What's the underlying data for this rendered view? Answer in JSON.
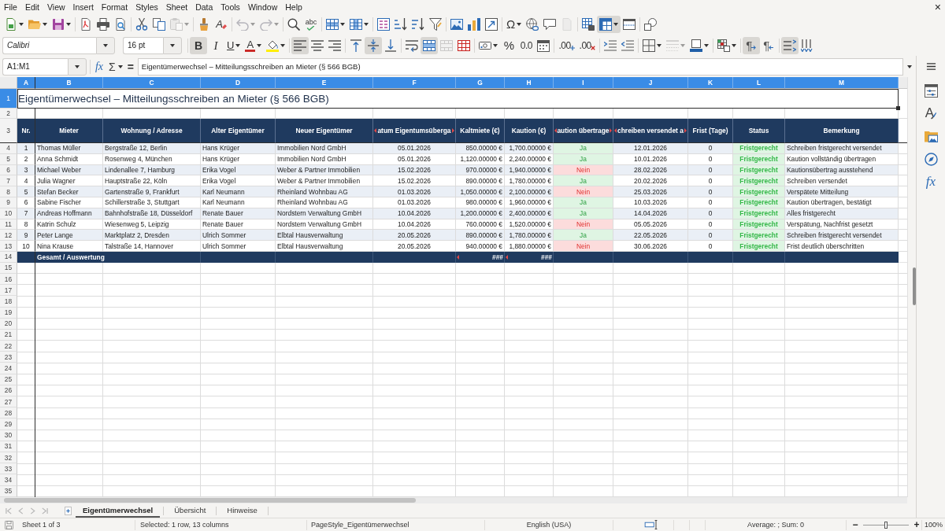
{
  "menu_bar": {
    "items": [
      "File",
      "Edit",
      "View",
      "Insert",
      "Format",
      "Styles",
      "Sheet",
      "Data",
      "Tools",
      "Window",
      "Help"
    ],
    "close": "×"
  },
  "standard_toolbar": {
    "groups": [
      {
        "buttons": [
          {
            "kind": "new",
            "dropdown": true,
            "on": false,
            "disabled": false
          },
          {
            "kind": "open",
            "dropdown": true,
            "on": false,
            "disabled": false
          },
          {
            "kind": "save",
            "dropdown": true,
            "on": false,
            "disabled": false
          }
        ]
      },
      {
        "buttons": [
          {
            "kind": "export_pdf",
            "dropdown": false,
            "on": false,
            "disabled": false
          },
          {
            "kind": "print",
            "dropdown": false,
            "on": false,
            "disabled": false
          },
          {
            "kind": "print_preview",
            "dropdown": false,
            "on": false,
            "disabled": false
          }
        ]
      },
      {
        "buttons": [
          {
            "kind": "cut",
            "dropdown": false,
            "on": false,
            "disabled": false
          },
          {
            "kind": "copy",
            "dropdown": false,
            "on": false,
            "disabled": false
          },
          {
            "kind": "paste",
            "dropdown": true,
            "on": false,
            "disabled": true
          }
        ]
      },
      {
        "buttons": [
          {
            "kind": "clone",
            "dropdown": false,
            "on": false,
            "disabled": false
          },
          {
            "kind": "clear_format",
            "label": "A",
            "dropdown": false,
            "on": false,
            "disabled": false
          }
        ]
      },
      {
        "buttons": [
          {
            "kind": "undo",
            "dropdown": true,
            "on": false,
            "disabled": true
          },
          {
            "kind": "redo",
            "dropdown": true,
            "on": false,
            "disabled": true
          }
        ]
      },
      {
        "buttons": [
          {
            "kind": "find_replace",
            "dropdown": false,
            "on": false,
            "disabled": false
          },
          {
            "kind": "spelling",
            "label": "abc",
            "dropdown": false,
            "on": false,
            "disabled": false
          }
        ]
      },
      {
        "buttons": [
          {
            "kind": "rows",
            "dropdown": true,
            "on": false,
            "disabled": false
          },
          {
            "kind": "columns",
            "dropdown": true,
            "on": false,
            "disabled": false
          }
        ]
      },
      {
        "buttons": [
          {
            "kind": "sort",
            "dropdown": false,
            "on": false,
            "disabled": false
          },
          {
            "kind": "sort_ascending",
            "dropdown": false,
            "on": false,
            "disabled": false
          },
          {
            "kind": "sort_descending",
            "dropdown": false,
            "on": false,
            "disabled": false
          },
          {
            "kind": "autofilter",
            "dropdown": false,
            "on": false,
            "disabled": false
          }
        ]
      },
      {
        "buttons": [
          {
            "kind": "image",
            "dropdown": false,
            "on": false,
            "disabled": false
          },
          {
            "kind": "chart",
            "dropdown": false,
            "on": false,
            "disabled": false
          },
          {
            "kind": "pivot_table",
            "dropdown": false,
            "on": false,
            "disabled": false
          }
        ]
      },
      {
        "buttons": [
          {
            "kind": "special_character",
            "label": "Ω",
            "dropdown": true,
            "on": false,
            "disabled": false
          },
          {
            "kind": "hyperlink",
            "dropdown": false,
            "on": false,
            "disabled": false
          },
          {
            "kind": "comment",
            "dropdown": false,
            "on": false,
            "disabled": false
          },
          {
            "kind": "header_footer",
            "dropdown": false,
            "on": false,
            "disabled": true
          }
        ]
      },
      {
        "buttons": [
          {
            "kind": "print_area",
            "dropdown": false,
            "on": false,
            "disabled": false
          },
          {
            "kind": "freeze",
            "dropdown": true,
            "on": true,
            "disabled": false
          },
          {
            "kind": "split_window",
            "dropdown": false,
            "on": false,
            "disabled": false
          }
        ]
      },
      {
        "buttons": [
          {
            "kind": "draw",
            "dropdown": false,
            "on": false,
            "disabled": false
          }
        ]
      }
    ]
  },
  "formatting_toolbar": {
    "font_name": "Calibri",
    "font_size": "16 pt",
    "groups": [
      {
        "buttons": [
          {
            "kind": "bold",
            "label": "B",
            "dropdown": false,
            "on": true,
            "disabled": false
          },
          {
            "kind": "italic",
            "label": "I",
            "dropdown": false,
            "on": false,
            "disabled": false
          },
          {
            "kind": "underline",
            "label": "U",
            "dropdown": true,
            "on": false,
            "disabled": false
          },
          {
            "kind": "font_color",
            "label": "A",
            "dropdown": true,
            "on": false,
            "disabled": false
          },
          {
            "kind": "highlight",
            "dropdown": true,
            "on": false,
            "disabled": false
          }
        ]
      },
      {
        "buttons": [
          {
            "kind": "align_left",
            "dropdown": false,
            "on": true,
            "disabled": false
          },
          {
            "kind": "align_center",
            "dropdown": false,
            "on": false,
            "disabled": false
          },
          {
            "kind": "align_right",
            "dropdown": false,
            "on": false,
            "disabled": false
          }
        ]
      },
      {
        "buttons": [
          {
            "kind": "align_top",
            "dropdown": false,
            "on": false,
            "disabled": false
          },
          {
            "kind": "align_middle",
            "dropdown": false,
            "on": true,
            "disabled": false
          },
          {
            "kind": "align_bottom",
            "dropdown": false,
            "on": false,
            "disabled": false
          }
        ]
      },
      {
        "buttons": [
          {
            "kind": "wrap_text",
            "dropdown": false,
            "on": false,
            "disabled": false
          },
          {
            "kind": "merge_center",
            "dropdown": false,
            "on": true,
            "disabled": false
          },
          {
            "kind": "merge_cells",
            "dropdown": false,
            "on": false,
            "disabled": true
          },
          {
            "kind": "unmerge_cells",
            "dropdown": false,
            "on": false,
            "disabled": false
          }
        ]
      },
      {
        "buttons": [
          {
            "kind": "number_format",
            "dropdown": true,
            "on": false,
            "disabled": false
          },
          {
            "kind": "percent",
            "label": "%",
            "dropdown": false,
            "on": false,
            "disabled": false
          },
          {
            "kind": "number",
            "label": "0.0",
            "dropdown": false,
            "on": false,
            "disabled": false
          },
          {
            "kind": "date",
            "dropdown": false,
            "on": false,
            "disabled": false
          }
        ]
      },
      {
        "buttons": [
          {
            "kind": "add_decimal",
            "label": ".00",
            "dropdown": false,
            "on": false,
            "disabled": false
          },
          {
            "kind": "delete_decimal",
            "label": ".00",
            "dropdown": false,
            "on": false,
            "disabled": false
          }
        ]
      },
      {
        "buttons": [
          {
            "kind": "indent_increase",
            "dropdown": false,
            "on": false,
            "disabled": false
          },
          {
            "kind": "indent_decrease",
            "dropdown": false,
            "on": false,
            "disabled": false
          }
        ]
      },
      {
        "buttons": [
          {
            "kind": "borders",
            "dropdown": true,
            "on": false,
            "disabled": false
          },
          {
            "kind": "border_style",
            "dropdown": true,
            "on": false,
            "disabled": true
          },
          {
            "kind": "border_color",
            "dropdown": true,
            "on": false,
            "disabled": false
          }
        ]
      },
      {
        "buttons": [
          {
            "kind": "conditional",
            "dropdown": true,
            "on": false,
            "disabled": false
          }
        ]
      },
      {
        "buttons": [
          {
            "kind": "left_to_right",
            "label": "¶",
            "dropdown": false,
            "on": true,
            "disabled": false
          },
          {
            "kind": "right_to_left",
            "label": "¶",
            "dropdown": false,
            "on": false,
            "disabled": false
          }
        ]
      },
      {
        "buttons": [
          {
            "kind": "text_horizontal",
            "dropdown": false,
            "on": true,
            "disabled": false
          },
          {
            "kind": "text_vertical",
            "dropdown": false,
            "on": false,
            "disabled": false
          }
        ]
      }
    ]
  },
  "formula_bar": {
    "name_box": "A1:M1",
    "function_wizard": "fx",
    "sum": "Σ",
    "equals": "=",
    "content": "Eigentümerwechsel – Mitteilungsschreiben an Mieter (§ 566 BGB)"
  },
  "spreadsheet": {
    "columns": [
      {
        "label": "A",
        "selected": true
      },
      {
        "label": "B",
        "selected": true
      },
      {
        "label": "C",
        "selected": true
      },
      {
        "label": "D",
        "selected": true
      },
      {
        "label": "E",
        "selected": true
      },
      {
        "label": "F",
        "selected": true
      },
      {
        "label": "G",
        "selected": true
      },
      {
        "label": "H",
        "selected": true
      },
      {
        "label": "I",
        "selected": true
      },
      {
        "label": "J",
        "selected": true
      },
      {
        "label": "K",
        "selected": true
      },
      {
        "label": "L",
        "selected": true
      },
      {
        "label": "M",
        "selected": true
      }
    ],
    "row_headers": [
      {
        "label": "1",
        "selected": true
      },
      {
        "label": "2",
        "selected": false
      },
      {
        "label": "3",
        "selected": false
      },
      {
        "label": "4",
        "selected": false
      },
      {
        "label": "5",
        "selected": false
      },
      {
        "label": "6",
        "selected": false
      },
      {
        "label": "7",
        "selected": false
      },
      {
        "label": "8",
        "selected": false
      },
      {
        "label": "9",
        "selected": false
      },
      {
        "label": "10",
        "selected": false
      },
      {
        "label": "11",
        "selected": false
      },
      {
        "label": "12",
        "selected": false
      },
      {
        "label": "13",
        "selected": false
      },
      {
        "label": "14",
        "selected": false
      },
      {
        "label": "15",
        "selected": false
      },
      {
        "label": "16",
        "selected": false
      },
      {
        "label": "17",
        "selected": false
      },
      {
        "label": "18",
        "selected": false
      },
      {
        "label": "19",
        "selected": false
      },
      {
        "label": "20",
        "selected": false
      },
      {
        "label": "21",
        "selected": false
      },
      {
        "label": "22",
        "selected": false
      },
      {
        "label": "23",
        "selected": false
      },
      {
        "label": "24",
        "selected": false
      },
      {
        "label": "25",
        "selected": false
      },
      {
        "label": "26",
        "selected": false
      },
      {
        "label": "27",
        "selected": false
      },
      {
        "label": "28",
        "selected": false
      },
      {
        "label": "29",
        "selected": false
      },
      {
        "label": "30",
        "selected": false
      },
      {
        "label": "31",
        "selected": false
      },
      {
        "label": "32",
        "selected": false
      },
      {
        "label": "33",
        "selected": false
      },
      {
        "label": "34",
        "selected": false
      },
      {
        "label": "35",
        "selected": false
      }
    ],
    "title": "Eigentümerwechsel – Mitteilungsschreiben an Mieter (§ 566 BGB)",
    "header": [
      {
        "text": "Nr.",
        "clipped": false
      },
      {
        "text": "Mieter",
        "clipped": false
      },
      {
        "text": "Wohnung / Adresse",
        "clipped": false
      },
      {
        "text": "Alter Eigentümer",
        "clipped": false
      },
      {
        "text": "Neuer Eigentümer",
        "clipped": false
      },
      {
        "text": "atum Eigentumsüberga",
        "clipped": true
      },
      {
        "text": "Kaltmiete (€)",
        "clipped": false
      },
      {
        "text": "Kaution (€)",
        "clipped": false
      },
      {
        "text": "aution übertrage",
        "clipped": true
      },
      {
        "text": "chreiben versendet a",
        "clipped": true
      },
      {
        "text": "Frist (Tage)",
        "clipped": false
      },
      {
        "text": "Status",
        "clipped": false
      },
      {
        "text": "Bemerkung",
        "clipped": false
      }
    ],
    "rows": [
      {
        "cells": [
          "1",
          "Thomas Müller",
          "Bergstraße 12, Berlin",
          "Hans Krüger",
          "Immobilien Nord GmbH",
          "05.01.2026",
          "850.00000 €",
          "1,700.00000 €",
          "Ja",
          "12.01.2026",
          "0",
          "Fristgerecht",
          "Schreiben fristgerecht versendet"
        ],
        "transferred": true,
        "on_time": true
      },
      {
        "cells": [
          "2",
          "Anna Schmidt",
          "Rosenweg 4, München",
          "Hans Krüger",
          "Immobilien Nord GmbH",
          "05.01.2026",
          "1,120.00000 €",
          "2,240.00000 €",
          "Ja",
          "10.01.2026",
          "0",
          "Fristgerecht",
          "Kaution vollständig übertragen"
        ],
        "transferred": true,
        "on_time": true
      },
      {
        "cells": [
          "3",
          "Michael Weber",
          "Lindenallee 7, Hamburg",
          "Erika Vogel",
          "Weber & Partner Immobilien",
          "15.02.2026",
          "970.00000 €",
          "1,940.00000 €",
          "Nein",
          "28.02.2026",
          "0",
          "Fristgerecht",
          "Kautionsübertrag ausstehend"
        ],
        "transferred": false,
        "on_time": true
      },
      {
        "cells": [
          "4",
          "Julia Wagner",
          "Hauptstraße 22, Köln",
          "Erika Vogel",
          "Weber & Partner Immobilien",
          "15.02.2026",
          "890.00000 €",
          "1,780.00000 €",
          "Ja",
          "20.02.2026",
          "0",
          "Fristgerecht",
          "Schreiben versendet"
        ],
        "transferred": true,
        "on_time": true
      },
      {
        "cells": [
          "5",
          "Stefan Becker",
          "Gartenstraße 9, Frankfurt",
          "Karl Neumann",
          "Rheinland Wohnbau AG",
          "01.03.2026",
          "1,050.00000 €",
          "2,100.00000 €",
          "Nein",
          "25.03.2026",
          "0",
          "Fristgerecht",
          "Verspätete Mitteilung"
        ],
        "transferred": false,
        "on_time": true
      },
      {
        "cells": [
          "6",
          "Sabine Fischer",
          "Schillerstraße 3, Stuttgart",
          "Karl Neumann",
          "Rheinland Wohnbau AG",
          "01.03.2026",
          "980.00000 €",
          "1,960.00000 €",
          "Ja",
          "10.03.2026",
          "0",
          "Fristgerecht",
          "Kaution übertragen, bestätigt"
        ],
        "transferred": true,
        "on_time": true
      },
      {
        "cells": [
          "7",
          "Andreas Hoffmann",
          "Bahnhofstraße 18, Düsseldorf",
          "Renate Bauer",
          "Nordstern Verwaltung GmbH",
          "10.04.2026",
          "1,200.00000 €",
          "2,400.00000 €",
          "Ja",
          "14.04.2026",
          "0",
          "Fristgerecht",
          "Alles fristgerecht"
        ],
        "transferred": true,
        "on_time": true
      },
      {
        "cells": [
          "8",
          "Katrin Schulz",
          "Wiesenweg 5, Leipzig",
          "Renate Bauer",
          "Nordstern Verwaltung GmbH",
          "10.04.2026",
          "760.00000 €",
          "1,520.00000 €",
          "Nein",
          "05.05.2026",
          "0",
          "Fristgerecht",
          "Verspätung, Nachfrist gesetzt"
        ],
        "transferred": false,
        "on_time": true
      },
      {
        "cells": [
          "9",
          "Peter Lange",
          "Marktplatz 2, Dresden",
          "Ulrich Sommer",
          "Elbtal Hausverwaltung",
          "20.05.2026",
          "890.00000 €",
          "1,780.00000 €",
          "Ja",
          "22.05.2026",
          "0",
          "Fristgerecht",
          "Schreiben fristgerecht versendet"
        ],
        "transferred": true,
        "on_time": true
      },
      {
        "cells": [
          "10",
          "Nina Krause",
          "Talstraße 14, Hannover",
          "Ulrich Sommer",
          "Elbtal Hausverwaltung",
          "20.05.2026",
          "940.00000 €",
          "1,880.00000 €",
          "Nein",
          "30.06.2026",
          "0",
          "Fristgerecht",
          "Frist deutlich überschritten"
        ],
        "transferred": false,
        "on_time": true
      }
    ],
    "total_row": {
      "label": "Gesamt / Auswertung",
      "kaltmiete": {
        "text": "###",
        "clipped": true
      },
      "kaution": {
        "text": "###",
        "clipped": true
      }
    }
  },
  "sidebar": {
    "tabs": [
      {
        "kind": "properties",
        "selected": false
      },
      {
        "kind": "styles",
        "glyph": "A",
        "selected": false
      },
      {
        "kind": "gallery",
        "selected": false
      },
      {
        "kind": "navigator",
        "selected": false
      },
      {
        "kind": "functions",
        "glyph": "fx",
        "selected": false
      }
    ]
  },
  "sheet_navigation": [
    {
      "kind": "first",
      "disabled": true
    },
    {
      "kind": "previous",
      "disabled": true
    },
    {
      "kind": "next",
      "disabled": true
    },
    {
      "kind": "last",
      "disabled": true
    }
  ],
  "sheet_tabs": [
    {
      "label": "Eigentümerwechsel",
      "selected": true
    },
    {
      "label": "Übersicht",
      "selected": false
    },
    {
      "label": "Hinweise",
      "selected": false
    }
  ],
  "status_bar": {
    "sheet": "Sheet 1 of 3",
    "selection": "Selected: 1 row, 13 columns",
    "page_style": "PageStyle_Eigentümerwechsel",
    "language": "English (USA)",
    "summary": "Average: ; Sum: 0",
    "zoom": {
      "minus": "−",
      "plus": "+",
      "level": 0.5,
      "reading": "100%"
    }
  }
}
